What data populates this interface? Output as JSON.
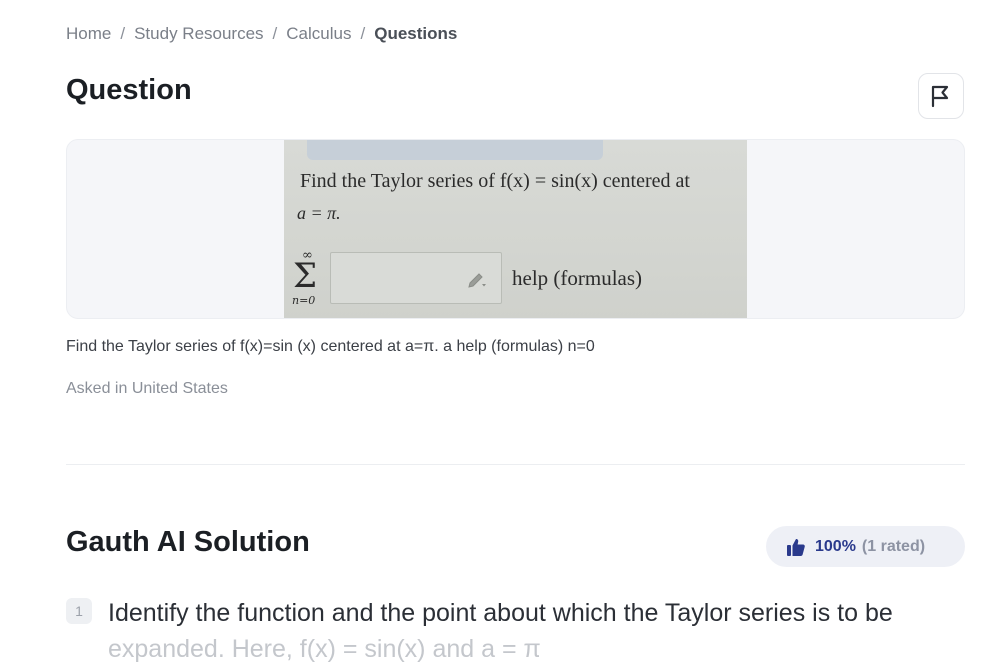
{
  "breadcrumb": {
    "items": [
      "Home",
      "Study Resources",
      "Calculus"
    ],
    "current": "Questions",
    "separator": "/"
  },
  "question": {
    "heading": "Question",
    "flag_icon": "flag-icon",
    "image": {
      "line1": "Find the Taylor series of f(x) = sin(x)  centered at",
      "line2": "a = π.",
      "sigma_upper": "∞",
      "sigma_symbol": "Σ",
      "sigma_lower": "n=0",
      "help_text": "help (formulas)",
      "input_icon": "pencil-icon"
    },
    "text": "Find the Taylor series of f(x)=sin (x) centered at a=π. a help (formulas) n=0",
    "asked_in": "Asked in United States"
  },
  "solution": {
    "heading": "Gauth AI Solution",
    "rating_icon": "thumbs-up-icon",
    "rating_percent": "100%",
    "rating_count": "(1 rated)",
    "accent_color": "#2a3a8c",
    "steps": [
      {
        "number": "1",
        "text": "Identify the function and the point about which the Taylor series is to be",
        "text_continued": "expanded. Here, f(x) = sin(x) and a = π"
      }
    ]
  }
}
